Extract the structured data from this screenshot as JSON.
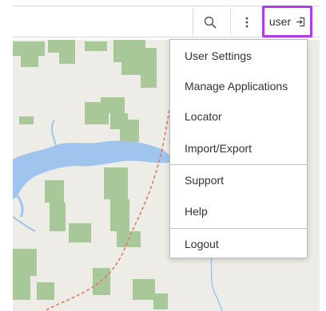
{
  "header": {
    "search_icon": "search-icon",
    "more_icon": "kebab-menu-icon",
    "user_label": "user",
    "user_icon": "sign-in-icon",
    "user_highlight_color": "#b23be8"
  },
  "map": {
    "land_color": "#eeece6",
    "forest_color": "#a9c89a",
    "water_color": "#9fc5ee",
    "road_color": "#e07a5f"
  },
  "user_menu": {
    "items": [
      {
        "label": "User Settings"
      },
      {
        "label": "Manage Applications"
      },
      {
        "label": "Locator"
      },
      {
        "label": "Import/Export"
      },
      {
        "label": "Support"
      },
      {
        "label": "Help"
      },
      {
        "label": "Logout"
      }
    ]
  }
}
